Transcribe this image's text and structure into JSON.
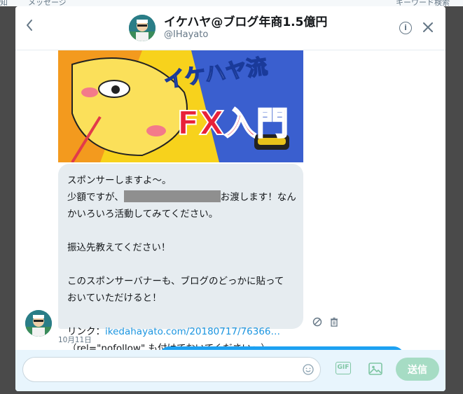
{
  "background": {
    "strip_left": "知",
    "strip_messages": "メッセージ",
    "strip_search": "キーワード検索"
  },
  "header": {
    "display_name": "イケハヤ@ブログ年商1.5億円",
    "handle": "@IHayato",
    "info_label": "i",
    "back_icon": "chevron-left",
    "close_icon": "x"
  },
  "banner": {
    "text_top": "イケハヤ流",
    "text_main": "FX入門"
  },
  "message": {
    "line1": "スポンサーしますよ〜。",
    "line2_prefix": "少額ですが、",
    "line2_suffix": "お渡します！なん",
    "line3": "かいろいろ活動してみてください。",
    "line4": "振込先教えてください！",
    "line5": "このスポンサーバナーも、ブログのどっかに貼って",
    "line6": "おいていただけると！",
    "link_prefix": "リンク：",
    "link_text": "ikedahayato.com/20180717/76366…",
    "line_last": "（rel=\"nofollow\" も付けておいてください〜）",
    "timestamp": "10月11日"
  },
  "composer": {
    "input_value": "",
    "gif_label": "GIF",
    "send_label": "送信"
  },
  "colors": {
    "accent": "#1da1f2",
    "link": "#1b95e0",
    "send_disabled": "#a6dcc4",
    "bubble": "#e6ecf0",
    "composer_bg": "#e8f5fd"
  }
}
